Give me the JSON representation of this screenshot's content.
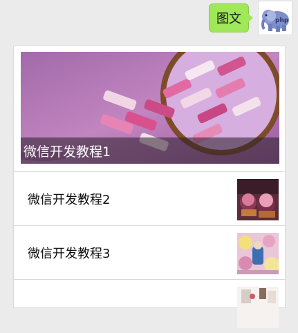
{
  "message": {
    "bubble_text": "图文"
  },
  "news": {
    "cover_title": "微信开发教程1",
    "items": [
      {
        "title": "微信开发教程2"
      },
      {
        "title": "微信开发教程3"
      },
      {
        "title": ""
      }
    ]
  },
  "icons": {
    "avatar": "elephant-avatar-icon"
  },
  "colors": {
    "background": "#ebebeb",
    "bubble": "#a0e75a",
    "card": "#ffffff",
    "title_overlay": "rgba(40,30,40,0.55)"
  }
}
